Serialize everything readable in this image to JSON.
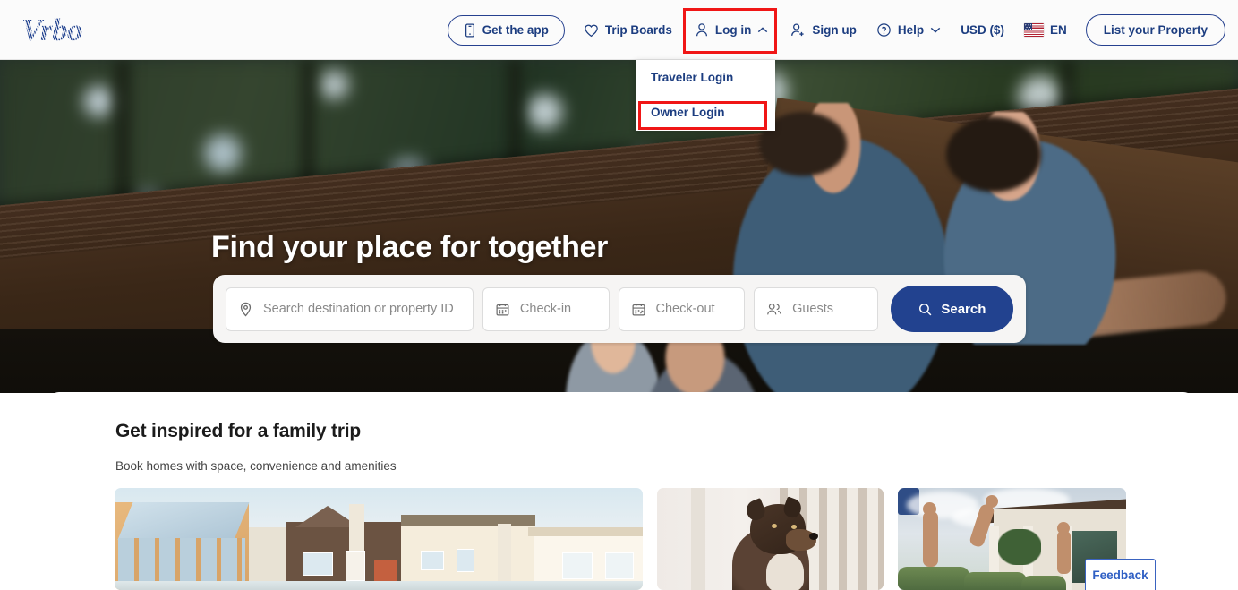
{
  "brand": {
    "logo_text": "Vrbo",
    "primary_color": "#22428f",
    "highlight_color": "#f01616"
  },
  "header": {
    "get_app": {
      "label": "Get the app",
      "icon": "mobile-phone-icon"
    },
    "trip_boards": {
      "label": "Trip Boards",
      "icon": "heart-icon"
    },
    "log_in": {
      "label": "Log in",
      "icon": "user-icon",
      "chevron": "chevron-up-icon",
      "expanded": true
    },
    "sign_up": {
      "label": "Sign up",
      "icon": "user-plus-icon"
    },
    "help": {
      "label": "Help",
      "icon": "question-circle-icon",
      "chevron": "chevron-down-icon"
    },
    "currency": {
      "label": "USD ($)"
    },
    "language": {
      "label": "EN",
      "icon": "us-flag-icon"
    },
    "list_property": {
      "label": "List your Property"
    }
  },
  "login_dropdown": {
    "items": [
      {
        "label": "Traveler Login",
        "highlighted": false
      },
      {
        "label": "Owner Login",
        "highlighted": true
      }
    ]
  },
  "hero": {
    "title": "Find your place for together"
  },
  "search": {
    "destination": {
      "placeholder": "Search destination or property ID",
      "value": "",
      "icon": "location-pin-icon"
    },
    "checkin": {
      "placeholder": "Check-in",
      "value": "",
      "icon": "calendar-icon"
    },
    "checkout": {
      "placeholder": "Check-out",
      "value": "",
      "icon": "calendar-icon"
    },
    "guests": {
      "placeholder": "Guests",
      "value": "",
      "icon": "guests-icon"
    },
    "submit": {
      "label": "Search",
      "icon": "magnifier-icon"
    }
  },
  "inspiration": {
    "title": "Get inspired for a family trip",
    "subtitle": "Book homes with space, convenience and amenities",
    "cards": [
      {
        "name": "beach-houses-photo"
      },
      {
        "name": "dog-on-porch-photo"
      },
      {
        "name": "pool-family-photo"
      }
    ]
  },
  "feedback": {
    "label": "Feedback"
  }
}
